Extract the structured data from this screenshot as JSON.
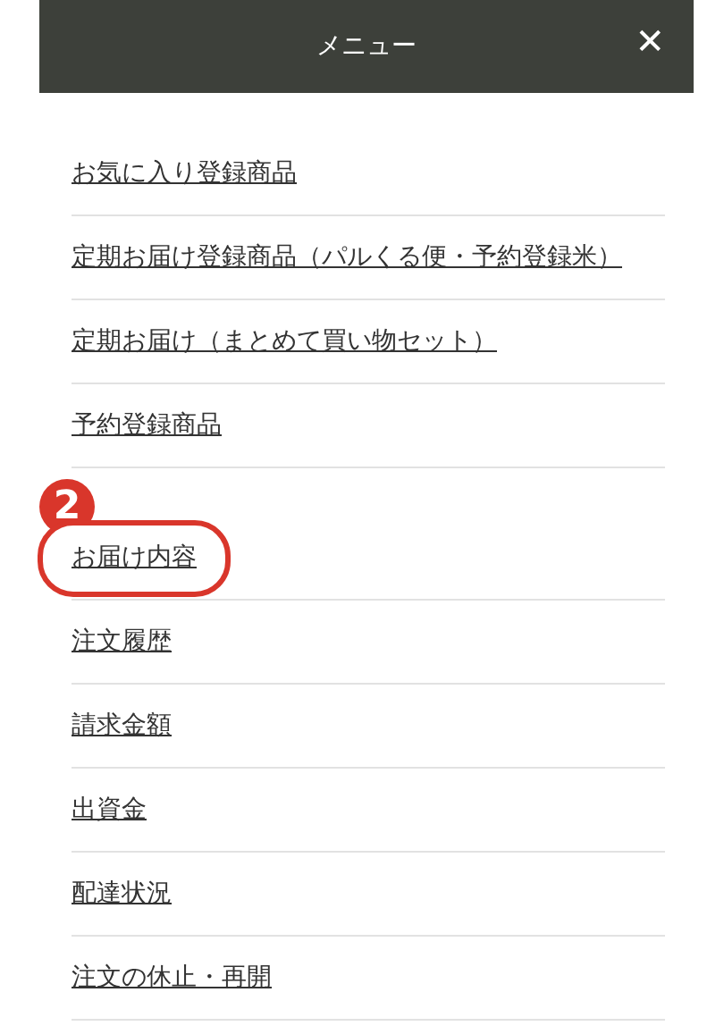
{
  "header": {
    "title": "メニュー",
    "close": "✕"
  },
  "groups": [
    {
      "items": [
        {
          "label": "お気に入り登録商品",
          "highlighted": false
        },
        {
          "label": "定期お届け登録商品（パルくる便・予約登録米）",
          "highlighted": false
        },
        {
          "label": "定期お届け（まとめて買い物セット）",
          "highlighted": false
        },
        {
          "label": "予約登録商品",
          "highlighted": false
        }
      ]
    },
    {
      "items": [
        {
          "label": "お届け内容",
          "highlighted": true,
          "callout": "2"
        },
        {
          "label": "注文履歴",
          "highlighted": false
        },
        {
          "label": "請求金額",
          "highlighted": false
        },
        {
          "label": "出資金",
          "highlighted": false
        },
        {
          "label": "配達状況",
          "highlighted": false
        },
        {
          "label": "注文の休止・再開",
          "highlighted": false
        }
      ]
    }
  ]
}
